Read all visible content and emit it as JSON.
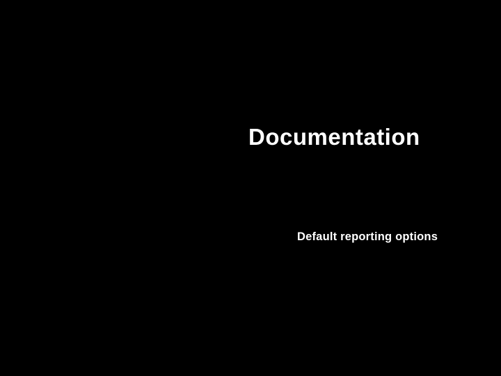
{
  "slide": {
    "title": "Documentation",
    "subtitle": "Default reporting options"
  }
}
